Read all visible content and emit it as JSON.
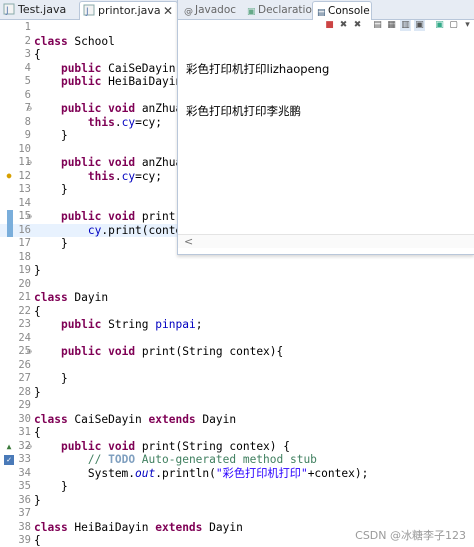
{
  "editor_tabs": [
    {
      "label": "Test.java",
      "active": false
    },
    {
      "label": "printor.java",
      "active": true,
      "close": "✕"
    }
  ],
  "console_panel": {
    "tabs": [
      "Javadoc",
      "Declaration",
      "Console"
    ],
    "active_tab": "Console",
    "output_lines": [
      "彩色打印机打印lizhaopeng",
      "彩色打印机打印李兆鹏"
    ],
    "scroll_arrow": "<"
  },
  "code_lines": [
    {
      "n": "1",
      "parts": []
    },
    {
      "n": "2",
      "parts": [
        {
          "t": "class",
          "c": "kw"
        },
        {
          "t": " School"
        }
      ]
    },
    {
      "n": "3",
      "parts": [
        {
          "t": "{"
        }
      ]
    },
    {
      "n": "4",
      "parts": [
        {
          "t": "    "
        },
        {
          "t": "public",
          "c": "kw"
        },
        {
          "t": " CaiSeDayin"
        }
      ]
    },
    {
      "n": "5",
      "parts": [
        {
          "t": "    "
        },
        {
          "t": "public",
          "c": "kw"
        },
        {
          "t": " HeiBaiDayin"
        }
      ]
    },
    {
      "n": "6",
      "parts": []
    },
    {
      "n": "7",
      "parts": [
        {
          "t": "    "
        },
        {
          "t": "public",
          "c": "kw"
        },
        {
          "t": " "
        },
        {
          "t": "void",
          "c": "kw"
        },
        {
          "t": " anZhua"
        }
      ]
    },
    {
      "n": "8",
      "parts": [
        {
          "t": "        "
        },
        {
          "t": "this",
          "c": "kw"
        },
        {
          "t": "."
        },
        {
          "t": "cy",
          "c": "field"
        },
        {
          "t": "=cy;"
        }
      ]
    },
    {
      "n": "9",
      "parts": [
        {
          "t": "    }"
        }
      ]
    },
    {
      "n": "10",
      "parts": []
    },
    {
      "n": "11",
      "parts": [
        {
          "t": "    "
        },
        {
          "t": "public",
          "c": "kw"
        },
        {
          "t": " "
        },
        {
          "t": "void",
          "c": "kw"
        },
        {
          "t": " anZhua"
        }
      ]
    },
    {
      "n": "12",
      "parts": [
        {
          "t": "        "
        },
        {
          "t": "this",
          "c": "kw"
        },
        {
          "t": "."
        },
        {
          "t": "cy",
          "c": "field"
        },
        {
          "t": "=cy;"
        }
      ]
    },
    {
      "n": "13",
      "parts": [
        {
          "t": "    }"
        }
      ]
    },
    {
      "n": "14",
      "parts": []
    },
    {
      "n": "15",
      "parts": [
        {
          "t": "    "
        },
        {
          "t": "public",
          "c": "kw"
        },
        {
          "t": " "
        },
        {
          "t": "void",
          "c": "kw"
        },
        {
          "t": " print("
        }
      ]
    },
    {
      "n": "16",
      "parts": [
        {
          "t": "        "
        },
        {
          "t": "cy",
          "c": "field"
        },
        {
          "t": ".print(conte"
        }
      ]
    },
    {
      "n": "17",
      "parts": [
        {
          "t": "    }"
        }
      ]
    },
    {
      "n": "18",
      "parts": []
    },
    {
      "n": "19",
      "parts": [
        {
          "t": "}"
        }
      ]
    },
    {
      "n": "20",
      "parts": []
    },
    {
      "n": "21",
      "parts": [
        {
          "t": "class",
          "c": "kw"
        },
        {
          "t": " Dayin"
        }
      ]
    },
    {
      "n": "22",
      "parts": [
        {
          "t": "{"
        }
      ]
    },
    {
      "n": "23",
      "parts": [
        {
          "t": "    "
        },
        {
          "t": "public",
          "c": "kw"
        },
        {
          "t": " String "
        },
        {
          "t": "pinpai",
          "c": "field"
        },
        {
          "t": ";"
        }
      ]
    },
    {
      "n": "24",
      "parts": []
    },
    {
      "n": "25",
      "parts": [
        {
          "t": "    "
        },
        {
          "t": "public",
          "c": "kw"
        },
        {
          "t": " "
        },
        {
          "t": "void",
          "c": "kw"
        },
        {
          "t": " print(String contex){"
        }
      ]
    },
    {
      "n": "26",
      "parts": []
    },
    {
      "n": "27",
      "parts": [
        {
          "t": "    }"
        }
      ]
    },
    {
      "n": "28",
      "parts": [
        {
          "t": "}"
        }
      ]
    },
    {
      "n": "29",
      "parts": []
    },
    {
      "n": "30",
      "parts": [
        {
          "t": "class",
          "c": "kw"
        },
        {
          "t": " CaiSeDayin "
        },
        {
          "t": "extends",
          "c": "kw"
        },
        {
          "t": " Dayin"
        }
      ]
    },
    {
      "n": "31",
      "parts": [
        {
          "t": "{"
        }
      ]
    },
    {
      "n": "32",
      "parts": [
        {
          "t": "    "
        },
        {
          "t": "public",
          "c": "kw"
        },
        {
          "t": " "
        },
        {
          "t": "void",
          "c": "kw"
        },
        {
          "t": " print(String contex) {"
        }
      ]
    },
    {
      "n": "33",
      "parts": [
        {
          "t": "        "
        },
        {
          "t": "// ",
          "c": "comment"
        },
        {
          "t": "TODO",
          "c": "todo"
        },
        {
          "t": " Auto-generated method stub",
          "c": "comment"
        }
      ]
    },
    {
      "n": "34",
      "parts": [
        {
          "t": "        System."
        },
        {
          "t": "out",
          "c": "static"
        },
        {
          "t": ".println("
        },
        {
          "t": "\"彩色打印机打印\"",
          "c": "str"
        },
        {
          "t": "+contex);"
        }
      ]
    },
    {
      "n": "35",
      "parts": [
        {
          "t": "    }"
        }
      ]
    },
    {
      "n": "36",
      "parts": [
        {
          "t": "}"
        }
      ]
    },
    {
      "n": "37",
      "parts": []
    },
    {
      "n": "38",
      "parts": [
        {
          "t": "class",
          "c": "kw"
        },
        {
          "t": " HeiBaiDayin "
        },
        {
          "t": "extends",
          "c": "kw"
        },
        {
          "t": " Dayin"
        }
      ]
    },
    {
      "n": "39",
      "parts": [
        {
          "t": "{"
        }
      ]
    }
  ],
  "gutter": {
    "current_line": "16",
    "fold_lines": [
      "7",
      "11",
      "15",
      "25",
      "32"
    ],
    "warning_lines": [
      "12"
    ],
    "override_lines": [
      "32"
    ],
    "task_lines": [
      "33"
    ],
    "fold_glyph": "⊖",
    "override_glyph": "▲",
    "task_glyph": "✓",
    "warning_glyph": "💡"
  },
  "watermark": "CSDN @冰糖李子123",
  "colors": {
    "keyword": "#7f0055",
    "field": "#0000c0",
    "comment": "#3f7f5f",
    "string": "#2a00ff",
    "current_line_bg": "#e8f2fe"
  }
}
